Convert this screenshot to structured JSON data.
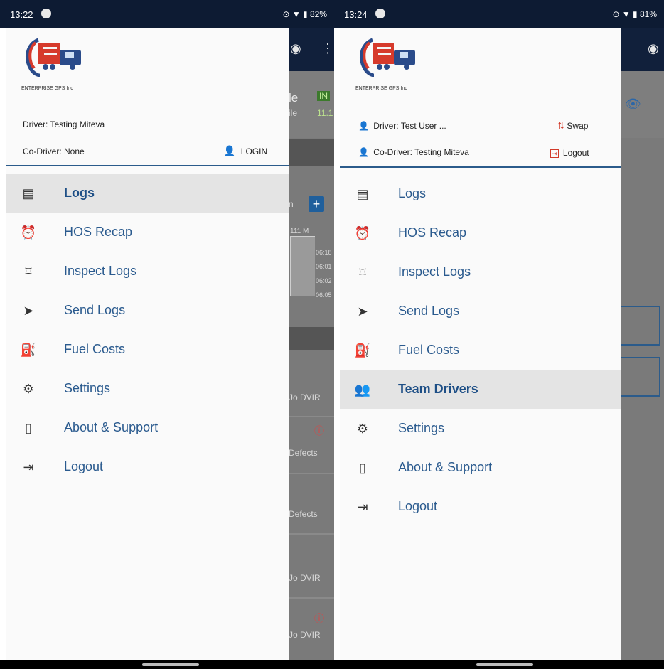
{
  "left": {
    "status": {
      "time": "13:22",
      "right": "⊙ ▼ ▮ 82%"
    },
    "background": {
      "title_fragment": "le",
      "sub_fragment": "ile",
      "badge1": "IN",
      "badge2": "11.1",
      "times": [
        "06:18",
        "06:01",
        "06:02",
        "06:05"
      ],
      "header_fragment": "111 M",
      "rows": [
        "Jo DVIR",
        "Defects",
        "Defects",
        "Jo DVIR",
        "Jo DVIR"
      ]
    },
    "driver": "Driver: Testing Miteva",
    "co_driver": "Co-Driver: None",
    "login_label": "LOGIN",
    "menu": [
      {
        "label": "Logs",
        "icon": "logs-icon",
        "selected": true
      },
      {
        "label": "HOS Recap",
        "icon": "alarm-clock-icon",
        "selected": false
      },
      {
        "label": "Inspect Logs",
        "icon": "inspect-icon",
        "selected": false
      },
      {
        "label": "Send Logs",
        "icon": "send-icon",
        "selected": false
      },
      {
        "label": "Fuel Costs",
        "icon": "fuel-icon",
        "selected": false
      },
      {
        "label": "Settings",
        "icon": "gear-icon",
        "selected": false
      },
      {
        "label": "About & Support",
        "icon": "phone-icon",
        "selected": false
      },
      {
        "label": "Logout",
        "icon": "logout-icon",
        "selected": false
      }
    ]
  },
  "right": {
    "status": {
      "time": "13:24",
      "right": "⊙ ▼ ▮ 81%"
    },
    "driver": "Driver: Test User ...",
    "co_driver": "Co-Driver: Testing Miteva",
    "swap_label": "Swap",
    "logout_label": "Logout",
    "menu": [
      {
        "label": "Logs",
        "icon": "logs-icon",
        "selected": false
      },
      {
        "label": "HOS Recap",
        "icon": "alarm-clock-icon",
        "selected": false
      },
      {
        "label": "Inspect Logs",
        "icon": "inspect-icon",
        "selected": false
      },
      {
        "label": "Send Logs",
        "icon": "send-icon",
        "selected": false
      },
      {
        "label": "Fuel Costs",
        "icon": "fuel-icon",
        "selected": false
      },
      {
        "label": "Team Drivers",
        "icon": "team-icon",
        "selected": true
      },
      {
        "label": "Settings",
        "icon": "gear-icon",
        "selected": false
      },
      {
        "label": "About & Support",
        "icon": "phone-icon",
        "selected": false
      },
      {
        "label": "Logout",
        "icon": "logout-icon",
        "selected": false
      }
    ]
  },
  "logo_text": "ENTERPRISE GPS Inc",
  "colors": {
    "accent": "#2a5a8e",
    "status_bar": "#0d1b33",
    "selected_bg": "#e4e4e4",
    "green": "#2e9e3a",
    "red": "#d23a2a"
  }
}
